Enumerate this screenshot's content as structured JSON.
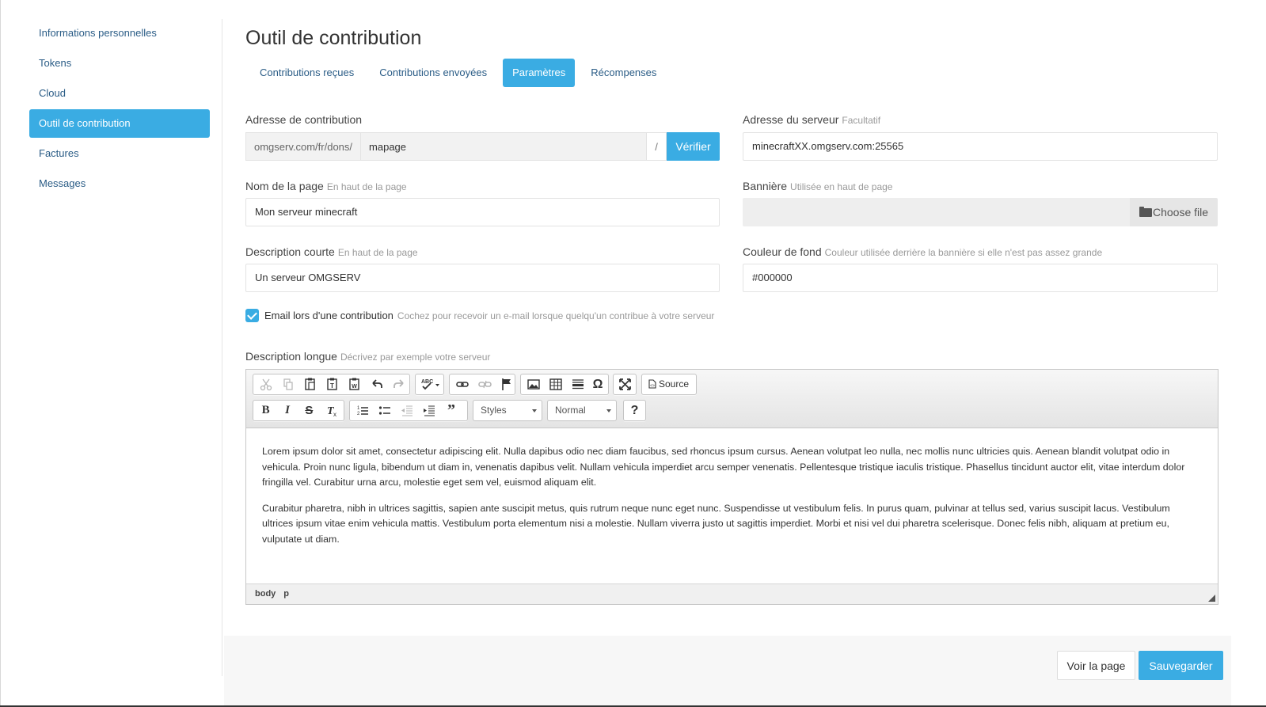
{
  "sidebar": {
    "items": [
      {
        "label": "Informations personnelles"
      },
      {
        "label": "Tokens"
      },
      {
        "label": "Cloud"
      },
      {
        "label": "Outil de contribution"
      },
      {
        "label": "Factures"
      },
      {
        "label": "Messages"
      }
    ],
    "active_index": 3
  },
  "page": {
    "title": "Outil de contribution"
  },
  "tabs": [
    {
      "label": "Contributions reçues"
    },
    {
      "label": "Contributions envoyées"
    },
    {
      "label": "Paramètres"
    },
    {
      "label": "Récompenses"
    }
  ],
  "form": {
    "contribution_address": {
      "label": "Adresse de contribution",
      "prefix": "omgserv.com/fr/dons/",
      "value": "mapage",
      "suffix": "/",
      "verify_label": "Vérifier"
    },
    "server_address": {
      "label": "Adresse du serveur",
      "hint": "Facultatif",
      "value": "minecraftXX.omgserv.com:25565"
    },
    "page_name": {
      "label": "Nom de la page",
      "hint": "En haut de la page",
      "value": "Mon serveur minecraft"
    },
    "banner": {
      "label": "Bannière",
      "hint": "Utilisée en haut de page",
      "button_label": "Choose file"
    },
    "short_description": {
      "label": "Description courte",
      "hint": "En haut de la page",
      "value": "Un serveur OMGSERV"
    },
    "background_color": {
      "label": "Couleur de fond",
      "hint": "Couleur utilisée derrière la bannière si elle n'est pas assez grande",
      "value": "#000000"
    },
    "email_on_contribution": {
      "label": "Email lors d'une contribution",
      "hint": "Cochez pour recevoir un e-mail lorsque quelqu'un contribue à votre serveur",
      "checked": true
    },
    "long_description": {
      "label": "Description longue",
      "hint": "Décrivez par exemple votre serveur",
      "toolbar": {
        "source_label": "Source",
        "styles_label": "Styles",
        "format_label": "Normal"
      },
      "paragraphs": [
        "Lorem ipsum dolor sit amet, consectetur adipiscing elit. Nulla dapibus odio nec diam faucibus, sed rhoncus ipsum cursus. Aenean volutpat leo nulla, nec mollis nunc ultricies quis. Aenean blandit volutpat odio in vehicula. Proin nunc ligula, bibendum ut diam in, venenatis dapibus velit. Nullam vehicula imperdiet arcu semper venenatis. Pellentesque tristique iaculis tristique. Phasellus tincidunt auctor elit, vitae interdum dolor fringilla vel. Curabitur urna arcu, molestie eget sem vel, euismod aliquam elit.",
        "Curabitur pharetra, nibh in ultrices sagittis, sapien ante suscipit metus, quis rutrum neque nunc eget nunc. Suspendisse ut vestibulum felis. In purus quam, pulvinar at tellus sed, varius suscipit lacus. Vestibulum ultrices ipsum vitae enim vehicula mattis. Vestibulum porta elementum nisi a molestie. Nullam viverra justo ut sagittis imperdiet. Morbi et nisi vel dui pharetra scelerisque. Donec felis nibh, aliquam at pretium eu, vulputate ut diam."
      ],
      "path": [
        "body",
        "p"
      ]
    }
  },
  "footer": {
    "view_label": "Voir la page",
    "save_label": "Sauvegarder"
  },
  "colors": {
    "accent": "#3aace3",
    "link": "#2a5c86"
  }
}
